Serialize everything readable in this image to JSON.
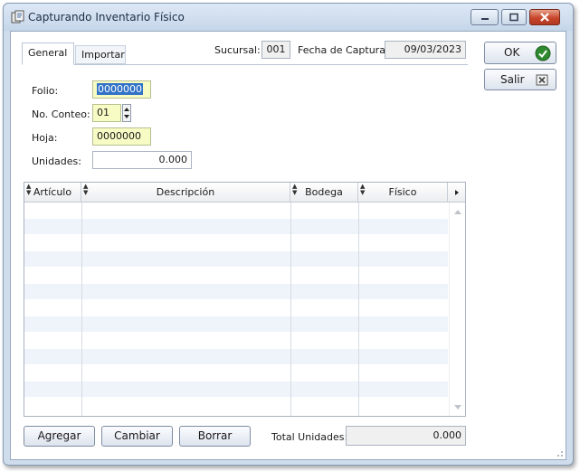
{
  "window": {
    "title": "Capturando Inventario Físico"
  },
  "tabs": [
    {
      "label": "General"
    },
    {
      "label": "Importar"
    }
  ],
  "header": {
    "sucursal_label": "Sucursal:",
    "sucursal_value": "001",
    "fecha_label": "Fecha de Captura:",
    "fecha_value": "09/03/2023"
  },
  "form": {
    "folio_label": "Folio:",
    "folio_value": "0000000",
    "conteo_label": "No. Conteo:",
    "conteo_value": "01",
    "hoja_label": "Hoja:",
    "hoja_value": "0000000",
    "unidades_label": "Unidades:",
    "unidades_value": "0.000"
  },
  "grid": {
    "columns": [
      "Artículo",
      "Descripción",
      "Bodega",
      "Físico"
    ],
    "rows": []
  },
  "actions": {
    "ok_label": "OK",
    "salir_label": "Salir",
    "agregar_label": "Agregar",
    "cambiar_label": "Cambiar",
    "borrar_label": "Borrar"
  },
  "footer": {
    "total_label": "Total Unidades:",
    "total_value": "0.000"
  },
  "icons": {
    "app": "inventory-app-icon",
    "ok": "check-circle-icon",
    "salir": "exit-x-icon"
  },
  "colors": {
    "ok_check": "#2f8a2f",
    "input_highlight": "#f6fcc4",
    "selection": "#3273c7"
  }
}
